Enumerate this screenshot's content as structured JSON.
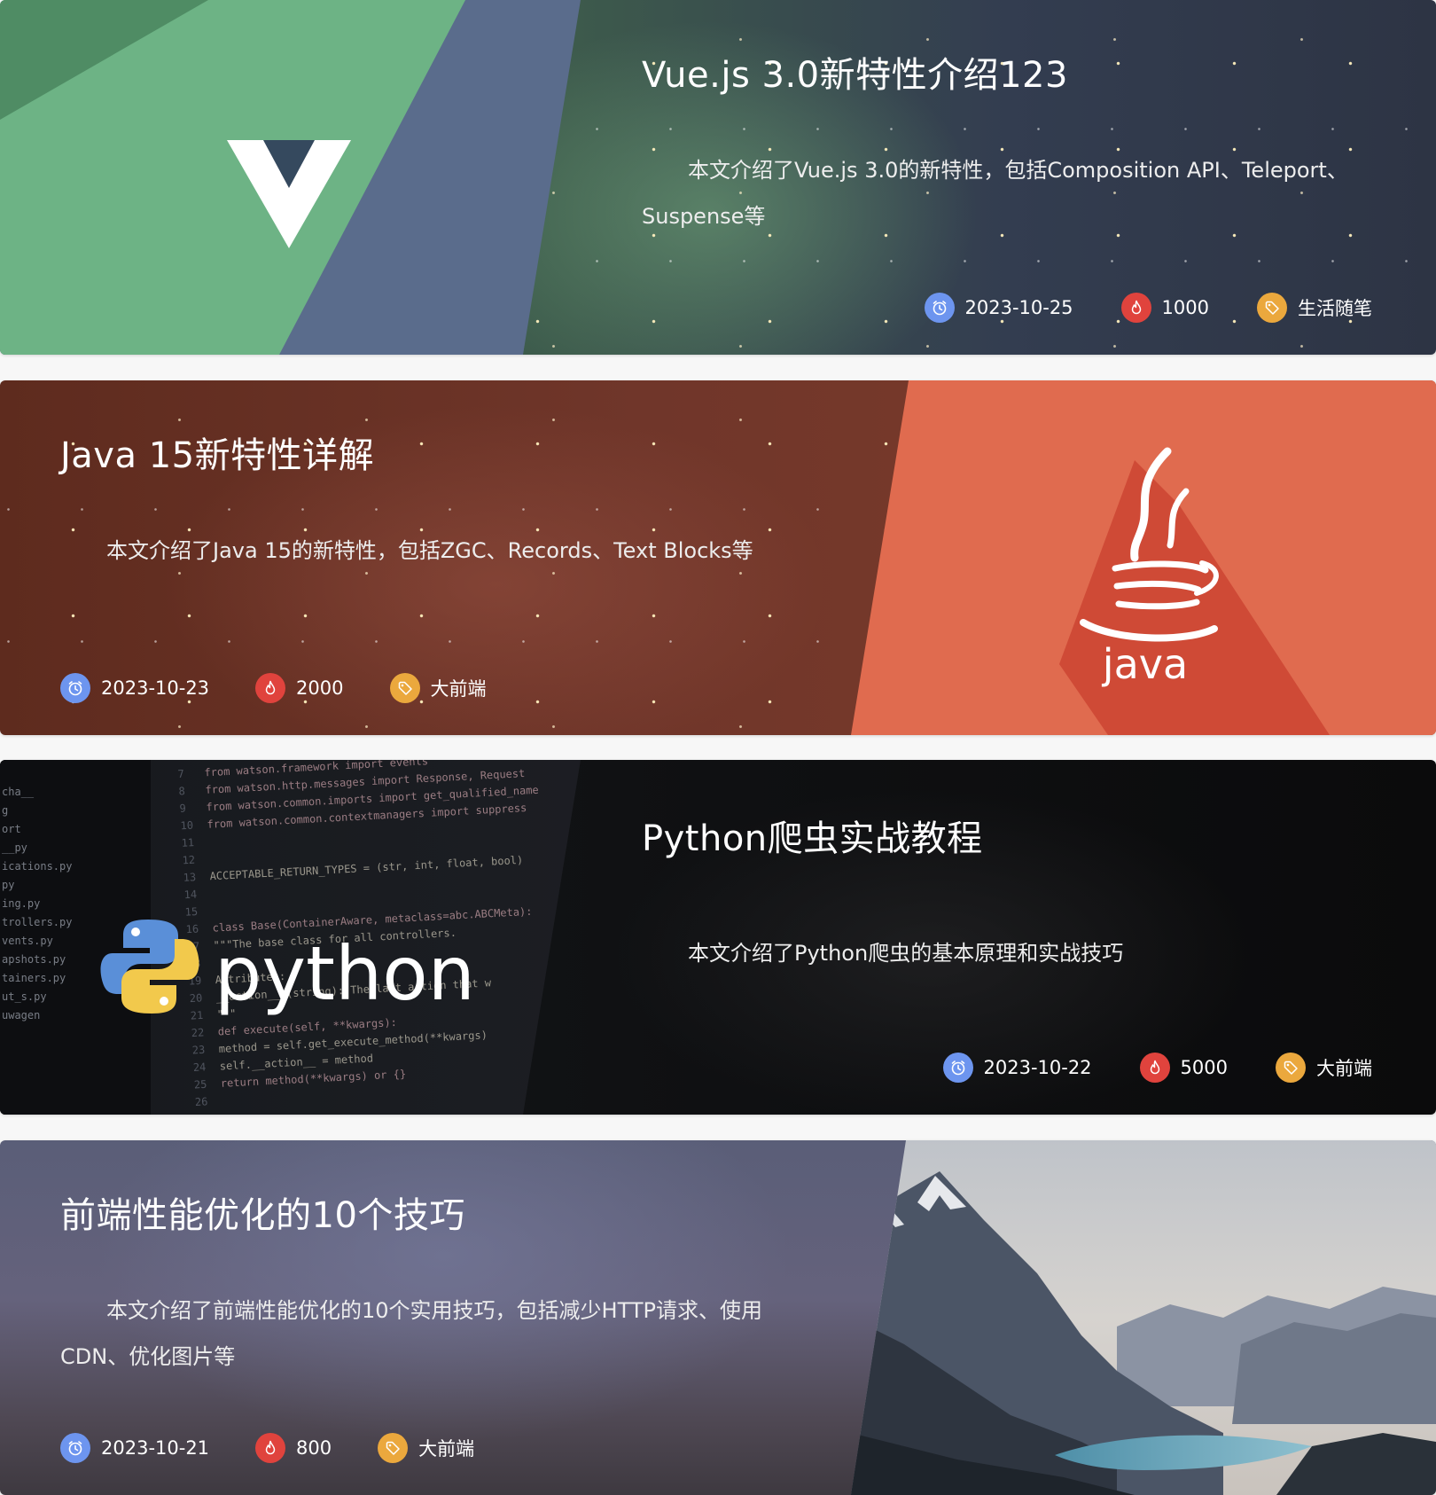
{
  "articles": [
    {
      "title": "Vue.js 3.0新特性介绍123",
      "summary": "本文介绍了Vue.js 3.0的新特性，包括Composition API、Teleport、Suspense等",
      "date": "2023-10-25",
      "views": "1000",
      "category": "生活随笔",
      "cover_icon": "vue-logo-icon"
    },
    {
      "title": "Java 15新特性详解",
      "summary": "本文介绍了Java 15的新特性，包括ZGC、Records、Text Blocks等",
      "date": "2023-10-23",
      "views": "2000",
      "category": "大前端",
      "cover_icon": "java-logo-icon",
      "cover_text": "java"
    },
    {
      "title": "Python爬虫实战教程",
      "summary": "本文介绍了Python爬虫的基本原理和实战技巧",
      "date": "2023-10-22",
      "views": "5000",
      "category": "大前端",
      "cover_icon": "python-logo-icon",
      "cover_text": "python",
      "cover_code": {
        "gutter": [
          "cha__",
          "g",
          "ort",
          "__py",
          "ications.py",
          "py",
          "ing.py",
          "trollers.py",
          "vents.py",
          "apshots.py",
          "tainers.py",
          "ut_s.py",
          "uwagen"
        ],
        "lines": [
          {
            "n": "7",
            "code": "from watson.framework import events"
          },
          {
            "n": "8",
            "code": "from watson.http.messages import Response, Request"
          },
          {
            "n": "9",
            "code": "from watson.common.imports import get_qualified_name"
          },
          {
            "n": "10",
            "code": "from watson.common.contextmanagers import suppress"
          },
          {
            "n": "11",
            "code": ""
          },
          {
            "n": "12",
            "code": ""
          },
          {
            "n": "13",
            "code": "ACCEPTABLE_RETURN_TYPES = (str, int, float, bool)"
          },
          {
            "n": "14",
            "code": ""
          },
          {
            "n": "15",
            "code": ""
          },
          {
            "n": "16",
            "code": "class Base(ContainerAware, metaclass=abc.ABCMeta):"
          },
          {
            "n": "17",
            "code": "    \"\"\"The base class for all controllers."
          },
          {
            "n": "18",
            "code": ""
          },
          {
            "n": "19",
            "code": "    Attributes:"
          },
          {
            "n": "20",
            "code": "        __action__ (string): The last action that w"
          },
          {
            "n": "21",
            "code": "    \"\"\""
          },
          {
            "n": "22",
            "code": "    def execute(self, **kwargs):"
          },
          {
            "n": "23",
            "code": "        method = self.get_execute_method(**kwargs)"
          },
          {
            "n": "24",
            "code": "        self.__action__ = method"
          },
          {
            "n": "25",
            "code": "        return method(**kwargs) or {}"
          },
          {
            "n": "26",
            "code": ""
          }
        ]
      }
    },
    {
      "title": "前端性能优化的10个技巧",
      "summary": "本文介绍了前端性能优化的10个实用技巧，包括减少HTTP请求、使用CDN、优化图片等",
      "date": "2023-10-21",
      "views": "800",
      "category": "大前端",
      "cover_icon": "mountain-lake-image"
    }
  ],
  "icons": {
    "date": "clock-icon",
    "views": "flame-icon",
    "category": "tag-icon"
  },
  "colors": {
    "vue_green": "#6db385",
    "vue_dark": "#35495e",
    "java_orange": "#e06b4f",
    "date_icon": "#6d95ef",
    "hot_icon": "#e0433d",
    "tag_icon": "#eba83d"
  }
}
